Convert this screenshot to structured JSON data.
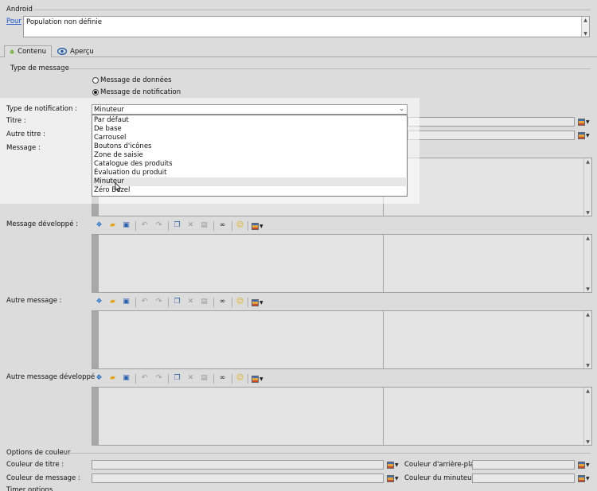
{
  "header": {
    "section_title": "Android",
    "pour_link": "Pour",
    "population_value": "Population non définie"
  },
  "tabs": [
    {
      "label": "Contenu",
      "icon": "android-icon",
      "active": true
    },
    {
      "label": "Aperçu",
      "icon": "eye-icon",
      "active": false
    }
  ],
  "message_type": {
    "group_title": "Type de message",
    "options": [
      {
        "label": "Message de données",
        "selected": false
      },
      {
        "label": "Message de notification",
        "selected": true
      }
    ]
  },
  "form": {
    "notif_type_label": "Type de notification :",
    "notif_type_value": "Minuteur",
    "title_label": "Titre :",
    "alt_title_label": "Autre titre :",
    "message_label": "Message :",
    "expanded_message_label": "Message développé :",
    "alt_message_label": "Autre message :",
    "alt_expanded_message_label": "Autre message développé :"
  },
  "dropdown": {
    "items": [
      "Par défaut",
      "De base",
      "Carrousel",
      "Boutons d'icônes",
      "Zone de saisie",
      "Catalogue des produits",
      "Évaluation du produit",
      "Minuteur",
      "Zéro Bezel"
    ],
    "highlighted": "Minuteur"
  },
  "color_options": {
    "group_title": "Options de couleur",
    "title_color_label": "Couleur de titre :",
    "bg_color_label": "Couleur d'arrière-plan :",
    "message_color_label": "Couleur de message :",
    "timer_color_label": "Couleur du minuteur :"
  },
  "footer_partial": "Timer options",
  "colors": {
    "link": "#1a56c9",
    "background": "#dcdcdc",
    "gutter": "#a8a8a8"
  }
}
